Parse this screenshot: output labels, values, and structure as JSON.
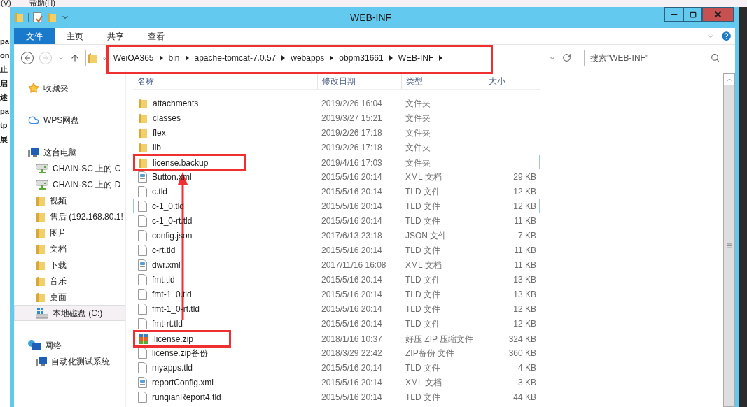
{
  "background_app": {
    "menu": [
      "(V)",
      "帮助(H)"
    ],
    "fragments": [
      "pa",
      "on",
      "止",
      "启",
      "述",
      "pa",
      "tp",
      "展"
    ]
  },
  "window": {
    "title": "WEB-INF"
  },
  "ribbon_tabs": [
    {
      "label": "文件",
      "selected": true
    },
    {
      "label": "主页",
      "selected": false
    },
    {
      "label": "共享",
      "selected": false
    },
    {
      "label": "查看",
      "selected": false
    }
  ],
  "address_bar": {
    "overflow": "«",
    "path": [
      "WeiOA365",
      "bin",
      "apache-tomcat-7.0.57",
      "webapps",
      "obpm31661",
      "WEB-INF"
    ]
  },
  "search": {
    "placeholder": "搜索\"WEB-INF\""
  },
  "sidebar": [
    {
      "label": "收藏夹",
      "kind": "favorites",
      "selected": false
    },
    {
      "label": "WPS网盘",
      "kind": "cloud",
      "selected": false
    },
    {
      "label": "这台电脑",
      "kind": "computer",
      "selected": false,
      "children": [
        {
          "label": "CHAIN-SC 上的 C",
          "kind": "drive",
          "selected": false
        },
        {
          "label": "CHAIN-SC 上的 D",
          "kind": "drive",
          "selected": false
        },
        {
          "label": "视频",
          "kind": "folder",
          "selected": false
        },
        {
          "label": "售后 (192.168.80.1!",
          "kind": "share",
          "selected": false
        },
        {
          "label": "图片",
          "kind": "folder",
          "selected": false
        },
        {
          "label": "文档",
          "kind": "folder",
          "selected": false
        },
        {
          "label": "下载",
          "kind": "folder",
          "selected": false
        },
        {
          "label": "音乐",
          "kind": "folder",
          "selected": false
        },
        {
          "label": "桌面",
          "kind": "folder",
          "selected": false
        },
        {
          "label": "本地磁盘 (C:)",
          "kind": "disk",
          "selected": true
        }
      ]
    },
    {
      "label": "网络",
      "kind": "network",
      "selected": false,
      "children": [
        {
          "label": "自动化测试系统",
          "kind": "computer",
          "selected": false
        }
      ]
    }
  ],
  "table": {
    "columns": [
      "名称",
      "修改日期",
      "类型",
      "大小"
    ],
    "rows": [
      {
        "kind": "folder",
        "name": "attachments",
        "modified": "2019/2/26 16:04",
        "type": "文件夹",
        "highlighted": false
      },
      {
        "kind": "folder",
        "name": "classes",
        "modified": "2019/3/27 15:21",
        "type": "文件夹",
        "highlighted": false
      },
      {
        "kind": "folder",
        "name": "flex",
        "modified": "2019/2/26 17:18",
        "type": "文件夹",
        "highlighted": false
      },
      {
        "kind": "folder",
        "name": "lib",
        "modified": "2019/2/26 17:18",
        "type": "文件夹",
        "highlighted": false
      },
      {
        "kind": "folder",
        "name": "license.backup",
        "modified": "2019/4/16 17:03",
        "type": "文件夹",
        "highlighted": true,
        "annotated": true
      },
      {
        "kind": "xml",
        "name": "Button.xml",
        "modified": "2015/5/16 20:14",
        "type": "XML 文档",
        "size": "29 KB",
        "highlighted": false
      },
      {
        "kind": "file",
        "name": "c.tld",
        "modified": "2015/5/16 20:14",
        "type": "TLD 文件",
        "size": "12 KB",
        "highlighted": false
      },
      {
        "kind": "file",
        "name": "c-1_0.tld",
        "modified": "2015/5/16 20:14",
        "type": "TLD 文件",
        "size": "12 KB",
        "highlighted": true
      },
      {
        "kind": "file",
        "name": "c-1_0-rt.tld",
        "modified": "2015/5/16 20:14",
        "type": "TLD 文件",
        "size": "11 KB",
        "highlighted": false
      },
      {
        "kind": "file",
        "name": "config.json",
        "modified": "2017/6/13 23:18",
        "type": "JSON 文件",
        "size": "7 KB",
        "highlighted": false
      },
      {
        "kind": "file",
        "name": "c-rt.tld",
        "modified": "2015/5/16 20:14",
        "type": "TLD 文件",
        "size": "11 KB",
        "highlighted": false
      },
      {
        "kind": "xml",
        "name": "dwr.xml",
        "modified": "2017/11/16 16:08",
        "type": "XML 文档",
        "size": "11 KB",
        "highlighted": false
      },
      {
        "kind": "file",
        "name": "fmt.tld",
        "modified": "2015/5/16 20:14",
        "type": "TLD 文件",
        "size": "13 KB",
        "highlighted": false
      },
      {
        "kind": "file",
        "name": "fmt-1_0.tld",
        "modified": "2015/5/16 20:14",
        "type": "TLD 文件",
        "size": "13 KB",
        "highlighted": false
      },
      {
        "kind": "file",
        "name": "fmt-1_0-rt.tld",
        "modified": "2015/5/16 20:14",
        "type": "TLD 文件",
        "size": "12 KB",
        "highlighted": false
      },
      {
        "kind": "file",
        "name": "fmt-rt.tld",
        "modified": "2015/5/16 20:14",
        "type": "TLD 文件",
        "size": "12 KB",
        "highlighted": false
      },
      {
        "kind": "zip",
        "name": "license.zip",
        "modified": "2018/1/16 10:37",
        "type": "好压 ZIP 压缩文件",
        "size": "324 KB",
        "highlighted": false,
        "annotated": true
      },
      {
        "kind": "file",
        "name": "license.zip备份",
        "modified": "2018/3/29 22:42",
        "type": "ZIP备份 文件",
        "size": "360 KB",
        "highlighted": false
      },
      {
        "kind": "file",
        "name": "myapps.tld",
        "modified": "2015/5/16 20:14",
        "type": "TLD 文件",
        "size": "4 KB",
        "highlighted": false
      },
      {
        "kind": "xml",
        "name": "reportConfig.xml",
        "modified": "2015/5/16 20:14",
        "type": "XML 文档",
        "size": "3 KB",
        "highlighted": false
      },
      {
        "kind": "file",
        "name": "runqianReport4.tld",
        "modified": "2015/5/16 20:14",
        "type": "TLD 文件",
        "size": "44 KB",
        "highlighted": false
      }
    ]
  }
}
